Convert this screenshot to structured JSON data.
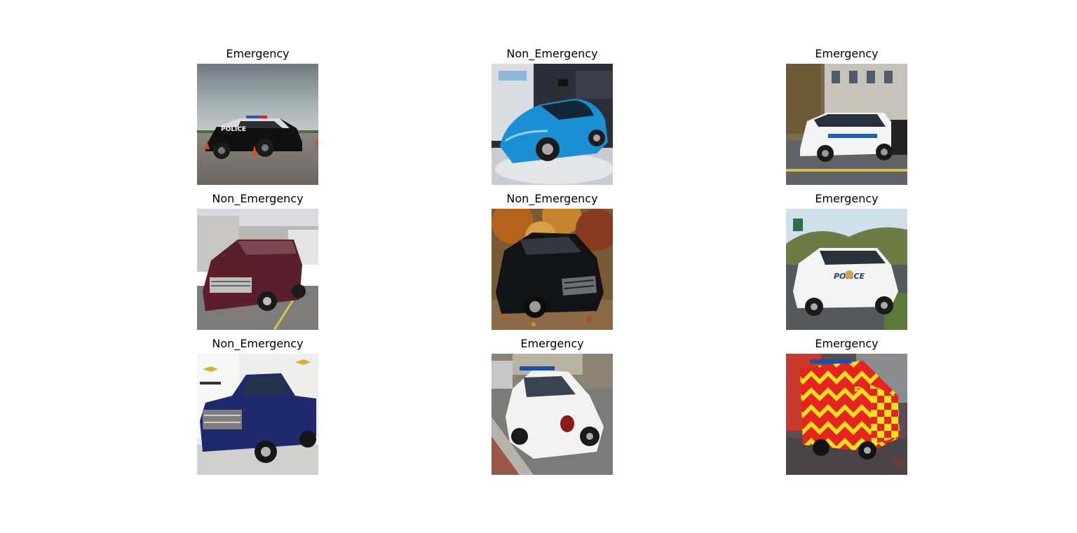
{
  "panels": [
    {
      "title": "Emergency"
    },
    {
      "title": "Non_Emergency"
    },
    {
      "title": "Emergency"
    },
    {
      "title": "Non_Emergency"
    },
    {
      "title": "Non_Emergency"
    },
    {
      "title": "Emergency"
    },
    {
      "title": "Non_Emergency"
    },
    {
      "title": "Emergency"
    },
    {
      "title": "Emergency"
    }
  ],
  "image_text": {
    "panel_0": "POLICE",
    "panel_5": "POLICE",
    "panel_8": "5"
  },
  "colors": {
    "background": "#ffffff",
    "title_text": "#000000"
  }
}
